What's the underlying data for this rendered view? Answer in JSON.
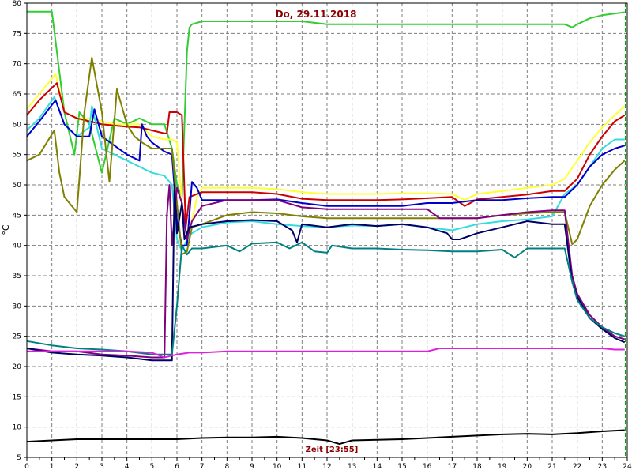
{
  "title": "Do, 29.11.2018",
  "colors": {
    "title": "#8b0000",
    "grid": "#7f7f7f",
    "axis": "#000000",
    "marker": "#00a000"
  },
  "chart_data": {
    "type": "line",
    "title": "Do, 29.11.2018",
    "ylabel": "°C",
    "xlabel": "Zeit [23:55]",
    "xlim": [
      0,
      24
    ],
    "ylim": [
      5,
      80
    ],
    "grid": true,
    "xticks": [
      0,
      1,
      2,
      3,
      4,
      5,
      6,
      7,
      8,
      9,
      10,
      11,
      12,
      13,
      14,
      15,
      16,
      17,
      18,
      19,
      20,
      21,
      22,
      23,
      24
    ],
    "yticks": [
      5,
      10,
      15,
      20,
      25,
      30,
      35,
      40,
      45,
      50,
      55,
      60,
      65,
      70,
      75,
      80
    ],
    "current_time_marker": 23.92,
    "series": [
      {
        "color": "#33cc33",
        "x": [
          0,
          1.0,
          1.2,
          1.5,
          1.9,
          2.1,
          2.5,
          3.0,
          3.5,
          4.0,
          4.5,
          5.0,
          5.5,
          5.8,
          6.0,
          6.2,
          6.3,
          6.4,
          6.5,
          6.6,
          7,
          8,
          9,
          10,
          11,
          12,
          13,
          14,
          15,
          16,
          17,
          18,
          19,
          20,
          21,
          21.5,
          21.8,
          22.0,
          22.5,
          23.0,
          23.9
        ],
        "y": [
          78.6,
          78.6,
          72,
          62,
          55,
          62,
          60,
          52,
          61,
          60,
          61,
          60,
          60,
          56,
          50,
          48,
          60,
          72,
          76,
          76.5,
          77,
          77,
          77,
          77,
          77,
          76.5,
          76.5,
          76.5,
          76.5,
          76.5,
          76.5,
          76.5,
          76.5,
          76.5,
          76.5,
          76.5,
          76,
          76.5,
          77.5,
          78,
          78.5
        ]
      },
      {
        "color": "#ffff33",
        "x": [
          0,
          0.5,
          1.15,
          1.5,
          2.0,
          2.5,
          3.0,
          3.5,
          4.0,
          4.5,
          5.0,
          5.5,
          5.8,
          6.0,
          6.2,
          6.4,
          6.6,
          6.8,
          7,
          8,
          9,
          10,
          11,
          12,
          13,
          14,
          15,
          16,
          17,
          17.5,
          18,
          19,
          20,
          21,
          21.5,
          22,
          22.5,
          23,
          23.5,
          23.9
        ],
        "y": [
          62.5,
          65,
          68.3,
          62,
          61,
          61,
          60.5,
          60,
          60,
          60,
          58,
          57.5,
          57.5,
          57,
          47,
          42,
          44,
          48,
          49.5,
          49.5,
          49.5,
          49.3,
          48.8,
          48.5,
          48.5,
          48.5,
          48.6,
          48.6,
          48.5,
          47.5,
          48.5,
          49,
          49.5,
          50,
          51,
          54,
          57,
          59.5,
          61.5,
          63
        ]
      },
      {
        "color": "#cc0000",
        "x": [
          0,
          0.5,
          1.2,
          1.5,
          2.0,
          2.5,
          3.0,
          3.5,
          4.0,
          4.5,
          5.0,
          5.5,
          5.6,
          5.7,
          6.0,
          6.2,
          6.35,
          6.5,
          7,
          8,
          9,
          10,
          11,
          12,
          13,
          14,
          15,
          16,
          17,
          17.5,
          18,
          19,
          20,
          21,
          21.5,
          22,
          22.5,
          23,
          23.5,
          23.9
        ],
        "y": [
          61.5,
          64,
          66.8,
          62,
          61,
          60.5,
          60,
          59.8,
          59.6,
          59.5,
          59,
          58.5,
          58.5,
          62,
          62,
          61.5,
          43,
          48,
          48.8,
          48.8,
          48.8,
          48.5,
          47.7,
          47.5,
          47.5,
          47.5,
          47.6,
          47.8,
          48,
          46.5,
          47.6,
          48,
          48.4,
          49,
          49,
          51,
          55,
          58,
          60.5,
          61.5
        ]
      },
      {
        "color": "#33dddd",
        "x": [
          0,
          0.5,
          1.1,
          1.5,
          2.0,
          2.5,
          2.6,
          3.0,
          3.5,
          4.0,
          4.5,
          5.0,
          5.5,
          5.8,
          6.0,
          6.2,
          6.4,
          6.6,
          7,
          8,
          9,
          10,
          11,
          12,
          13,
          14,
          15,
          16,
          17,
          18,
          19,
          20,
          21,
          21.5,
          22,
          22.5,
          23,
          23.5,
          23.9
        ],
        "y": [
          59,
          61,
          64.5,
          60,
          58,
          59.5,
          63,
          56,
          55,
          54,
          53,
          52,
          51.5,
          50,
          41,
          39,
          41,
          42,
          43,
          43.8,
          44,
          43.5,
          43.2,
          43,
          43.3,
          43.2,
          43.5,
          43,
          42.5,
          43.5,
          44,
          44.3,
          44.8,
          48.5,
          50,
          53,
          56,
          57.5,
          57.5
        ]
      },
      {
        "color": "#0000cc",
        "x": [
          0,
          0.5,
          1.15,
          1.5,
          2.0,
          2.5,
          2.7,
          3.0,
          3.5,
          4.0,
          4.5,
          4.6,
          4.8,
          5.0,
          5.5,
          5.8,
          6.0,
          6.2,
          6.4,
          6.6,
          6.8,
          7,
          8,
          9,
          10,
          11,
          12,
          13,
          14,
          15,
          16,
          17,
          18,
          19,
          20,
          21,
          21.5,
          22,
          22.5,
          23,
          23.5,
          23.9
        ],
        "y": [
          58,
          60.5,
          64,
          60,
          58,
          58,
          62.5,
          58,
          56.5,
          55,
          54,
          60,
          58,
          57,
          55.5,
          55,
          44,
          40,
          40,
          50.5,
          49.5,
          47.5,
          47.5,
          47.5,
          47.6,
          47,
          46.5,
          46.5,
          46.5,
          46.5,
          47,
          47,
          47.5,
          47.5,
          47.8,
          48,
          48,
          50,
          53,
          55,
          56,
          56.5
        ]
      },
      {
        "color": "#808000",
        "x": [
          0,
          0.5,
          1.1,
          1.3,
          1.5,
          2.0,
          2.3,
          2.6,
          3.0,
          3.3,
          3.6,
          4.0,
          4.3,
          4.6,
          5.0,
          5.5,
          5.8,
          6.0,
          6.2,
          6.4,
          6.6,
          7,
          8,
          9,
          10,
          11,
          12,
          13,
          14,
          15,
          16,
          17,
          18,
          19,
          20,
          21,
          21.5,
          21.8,
          22,
          22.5,
          23,
          23.5,
          23.9
        ],
        "y": [
          54,
          55,
          59,
          52,
          48,
          45.5,
          62,
          71,
          62,
          50.5,
          65.8,
          60,
          58,
          57,
          56,
          56,
          56,
          47,
          38.5,
          39,
          43,
          43.5,
          45,
          45.5,
          45.3,
          44.8,
          44.5,
          44.5,
          44.5,
          44.5,
          44.5,
          44.5,
          44.5,
          45,
          45.3,
          45.5,
          45.5,
          40.2,
          41,
          46.5,
          50,
          52.5,
          54
        ]
      },
      {
        "color": "#800080",
        "x": [
          0,
          1,
          2,
          3,
          4,
          5,
          5.5,
          5.6,
          5.7,
          5.8,
          6.0,
          6.2,
          6.4,
          6.6,
          7,
          8,
          9,
          10,
          11,
          12,
          13,
          14,
          15,
          16,
          16.5,
          17,
          18,
          19,
          20,
          21,
          21.5,
          21.8,
          22,
          22.5,
          23,
          23.5,
          23.9
        ],
        "y": [
          23,
          22.5,
          22.5,
          22,
          21.8,
          21.5,
          21.5,
          45,
          50,
          40,
          49.5,
          47,
          41,
          44,
          46.5,
          47.5,
          47.5,
          47.5,
          46.3,
          46,
          46,
          46,
          46,
          46,
          44.5,
          44.5,
          44.5,
          45,
          45.5,
          45.8,
          45.8,
          35,
          32,
          28.5,
          26.5,
          25,
          24.5
        ]
      },
      {
        "color": "#000066",
        "x": [
          0,
          1,
          2,
          3,
          4,
          5,
          5.5,
          5.8,
          5.9,
          6.0,
          6.2,
          6.3,
          6.5,
          7,
          8,
          9,
          10,
          10.6,
          10.8,
          11,
          12,
          13,
          14,
          15,
          16,
          16.8,
          17,
          17.3,
          18,
          19,
          20,
          21,
          21.5,
          21.8,
          22,
          22.5,
          23,
          23.5,
          23.9
        ],
        "y": [
          23,
          22.3,
          22,
          21.8,
          21.5,
          21,
          21,
          21,
          50,
          42,
          47,
          41,
          43,
          43.5,
          44,
          44.2,
          44,
          42.5,
          40.5,
          43.5,
          43,
          43.5,
          43.2,
          43.5,
          43,
          42,
          41,
          41,
          42,
          43,
          44,
          43.5,
          43.5,
          34,
          31.5,
          28,
          26.2,
          24.7,
          24
        ]
      },
      {
        "color": "#008080",
        "x": [
          0,
          1,
          2,
          3,
          4,
          5,
          5.5,
          5.8,
          6.0,
          6.2,
          6.4,
          6.6,
          7,
          8,
          8.5,
          9,
          10,
          10.5,
          11,
          11.5,
          12,
          12.2,
          13,
          14,
          15,
          16,
          17,
          18,
          19,
          19.5,
          20,
          21,
          21.5,
          21.8,
          22,
          22.5,
          23,
          23.5,
          23.9
        ],
        "y": [
          24.2,
          23.5,
          23,
          22.8,
          22.5,
          22,
          22,
          22,
          30,
          40,
          38.5,
          39.5,
          39.5,
          40,
          39,
          40.3,
          40.5,
          39.5,
          40.5,
          39,
          38.8,
          40,
          39.5,
          39.5,
          39.3,
          39.2,
          39,
          39,
          39.3,
          38,
          39.5,
          39.5,
          39.5,
          34,
          31,
          28,
          26.5,
          25.5,
          25
        ]
      },
      {
        "color": "#dd22dd",
        "x": [
          0,
          1,
          2,
          3,
          4,
          5,
          5.5,
          6.0,
          6.5,
          7,
          8,
          9,
          10,
          11,
          12,
          13,
          14,
          15,
          16,
          16.5,
          17,
          18,
          19,
          20,
          21,
          22,
          23,
          23.5,
          23.9
        ],
        "y": [
          22.5,
          22.5,
          22.5,
          22.5,
          22.5,
          22.3,
          21.5,
          22,
          22.3,
          22.3,
          22.5,
          22.5,
          22.5,
          22.5,
          22.5,
          22.5,
          22.5,
          22.5,
          22.5,
          23,
          23,
          23,
          23,
          23,
          23,
          23,
          23,
          22.8,
          22.8
        ]
      },
      {
        "color": "#000000",
        "x": [
          0,
          1,
          2,
          3,
          4,
          5,
          6,
          7,
          8,
          9,
          10,
          11,
          12,
          12.5,
          13,
          14,
          15,
          16,
          17,
          18,
          19,
          20,
          21,
          22,
          23,
          23.9
        ],
        "y": [
          7.6,
          7.8,
          8,
          8,
          8,
          8,
          8,
          8.2,
          8.3,
          8.3,
          8.4,
          8.2,
          7.8,
          7.2,
          7.8,
          7.9,
          8,
          8.2,
          8.4,
          8.6,
          8.8,
          8.9,
          8.8,
          9,
          9.3,
          9.5
        ]
      }
    ]
  }
}
